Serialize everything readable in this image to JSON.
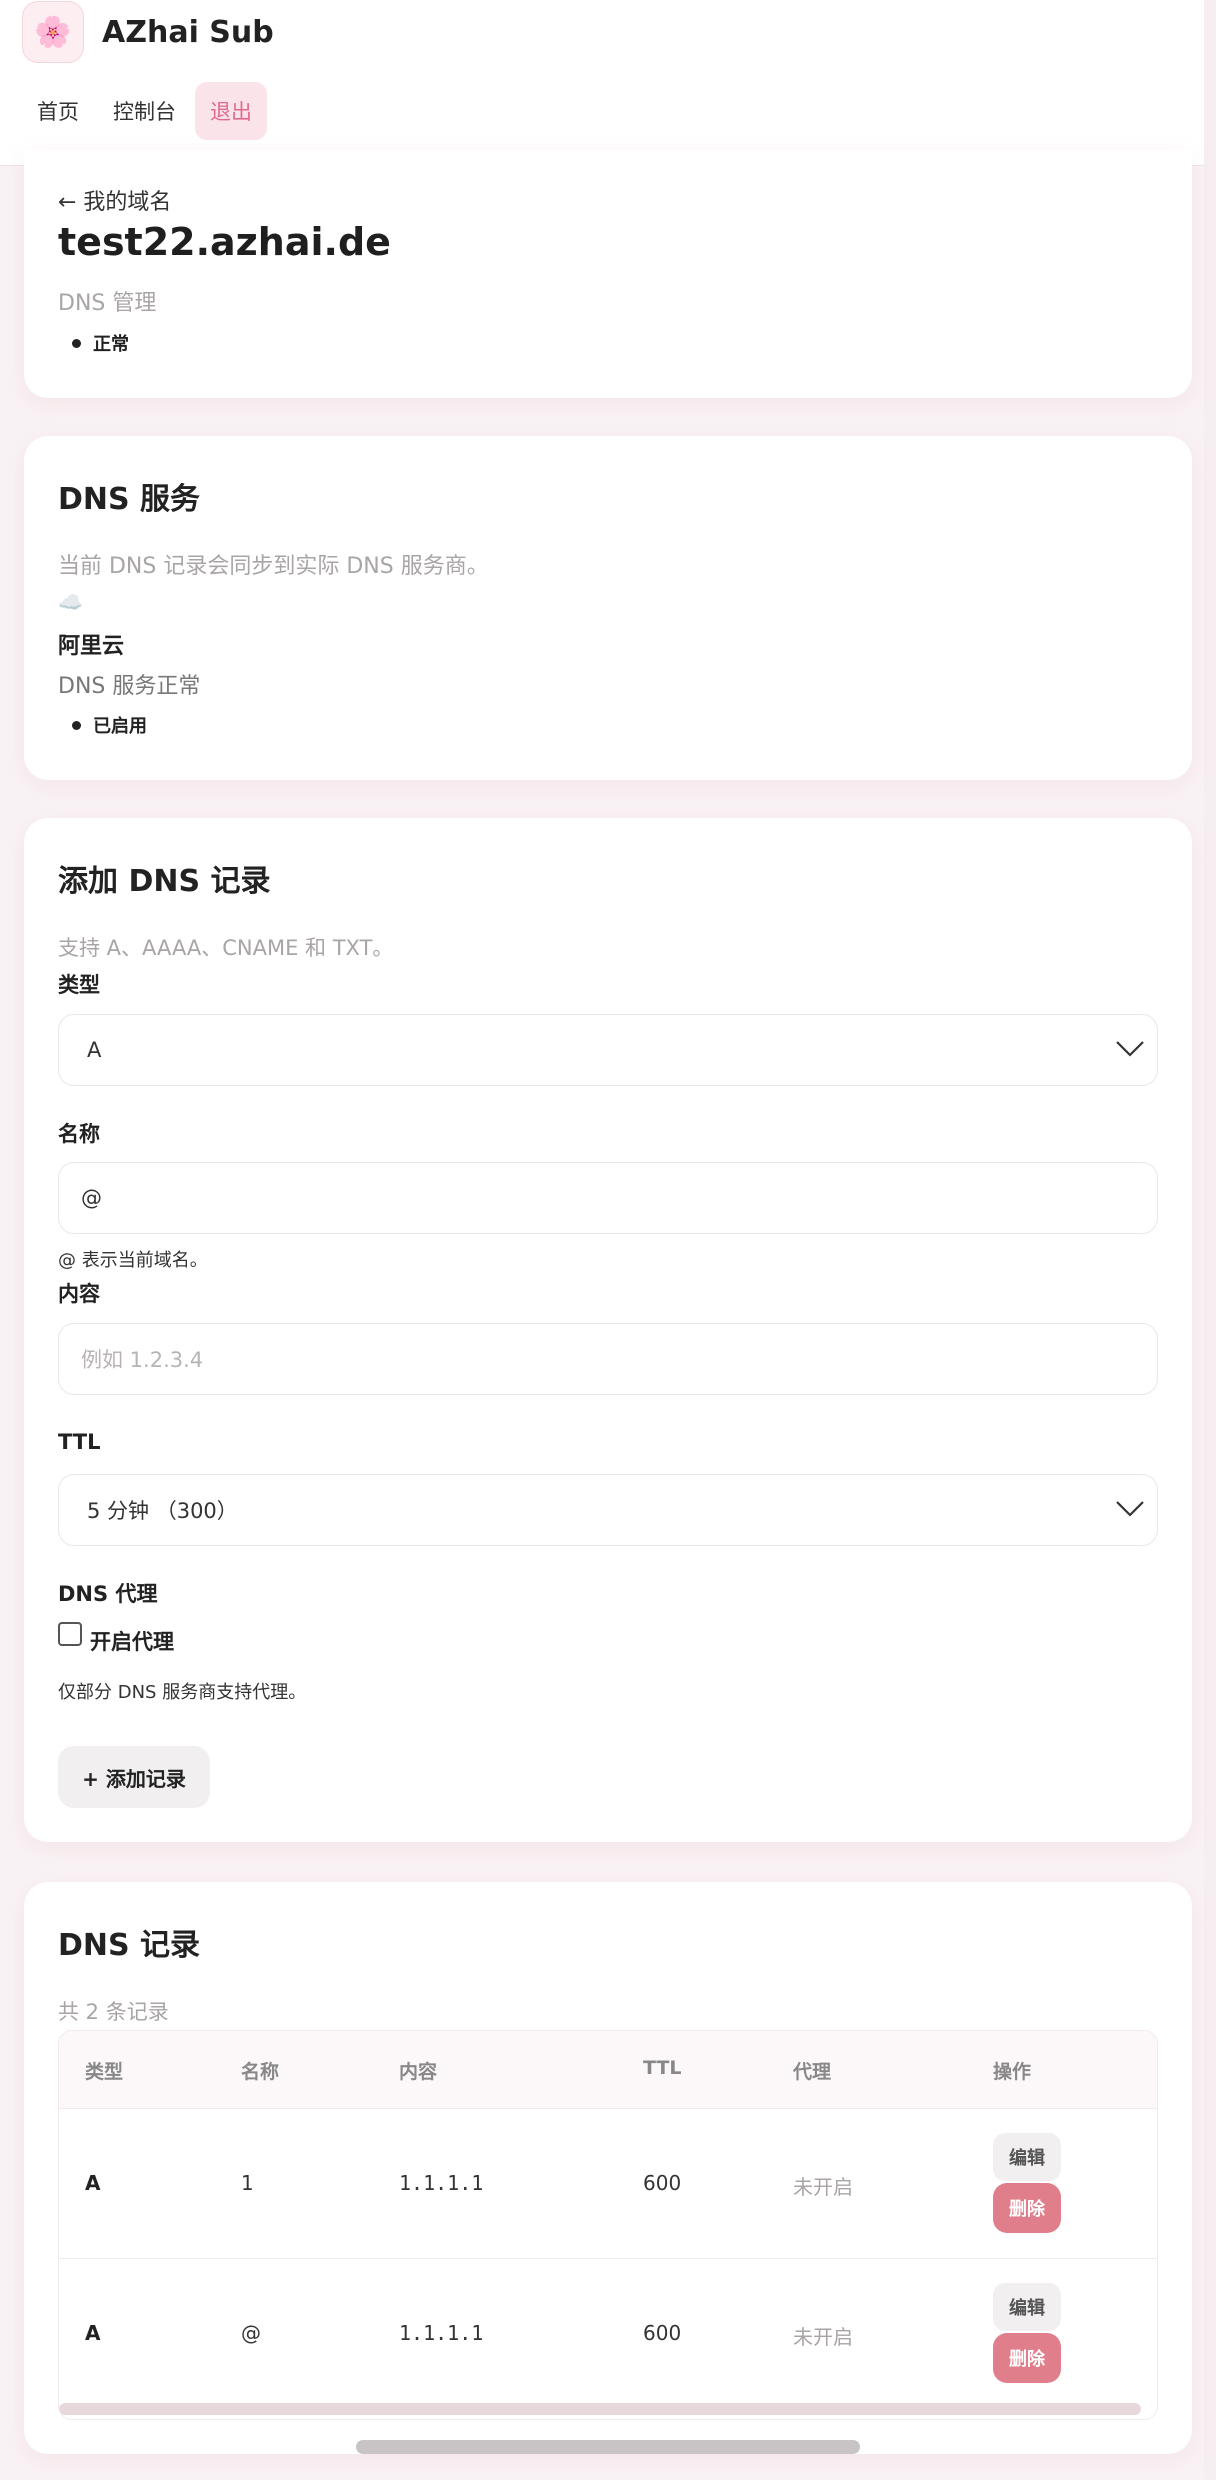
{
  "header": {
    "logo_icon": "cherry-blossom-icon",
    "logo_glyph": "🌸",
    "brand": "AZhai Sub",
    "nav": [
      {
        "label": "首页"
      },
      {
        "label": "控制台"
      },
      {
        "label": "退出"
      }
    ]
  },
  "domain": {
    "back_link": "← 我的域名",
    "name": "test22.azhai.de",
    "subtitle": "DNS 管理",
    "status": "正常"
  },
  "dns_service": {
    "title": "DNS 服务",
    "description": "当前 DNS 记录会同步到实际 DNS 服务商。",
    "provider_icon": "cloud-icon",
    "provider_glyph": "☁️",
    "provider_name": "阿里云",
    "provider_status": "DNS 服务正常",
    "badge": "已启用"
  },
  "add_record": {
    "title": "添加 DNS 记录",
    "description": "支持 A、AAAA、CNAME 和 TXT。",
    "type_label": "类型",
    "type_value": "A",
    "name_label": "名称",
    "name_value": "@",
    "name_hint": "@ 表示当前域名。",
    "content_label": "内容",
    "content_placeholder": "例如 1.2.3.4",
    "ttl_label": "TTL",
    "ttl_value": "5 分钟 （300）",
    "proxy_label": "DNS 代理",
    "proxy_checkbox_label": "开启代理",
    "proxy_checked": false,
    "proxy_hint": "仅部分 DNS 服务商支持代理。",
    "submit_label": "+ 添加记录"
  },
  "records": {
    "title": "DNS 记录",
    "count_text": "共 2 条记录",
    "columns": [
      "类型",
      "名称",
      "内容",
      "TTL",
      "代理",
      "操作"
    ],
    "rows": [
      {
        "type": "A",
        "name": "1",
        "content": "1.1.1.1",
        "ttl": "600",
        "proxy": "未开启",
        "edit": "编辑",
        "delete": "删除"
      },
      {
        "type": "A",
        "name": "@",
        "content": "1.1.1.1",
        "ttl": "600",
        "proxy": "未开启",
        "edit": "编辑",
        "delete": "删除"
      }
    ]
  }
}
